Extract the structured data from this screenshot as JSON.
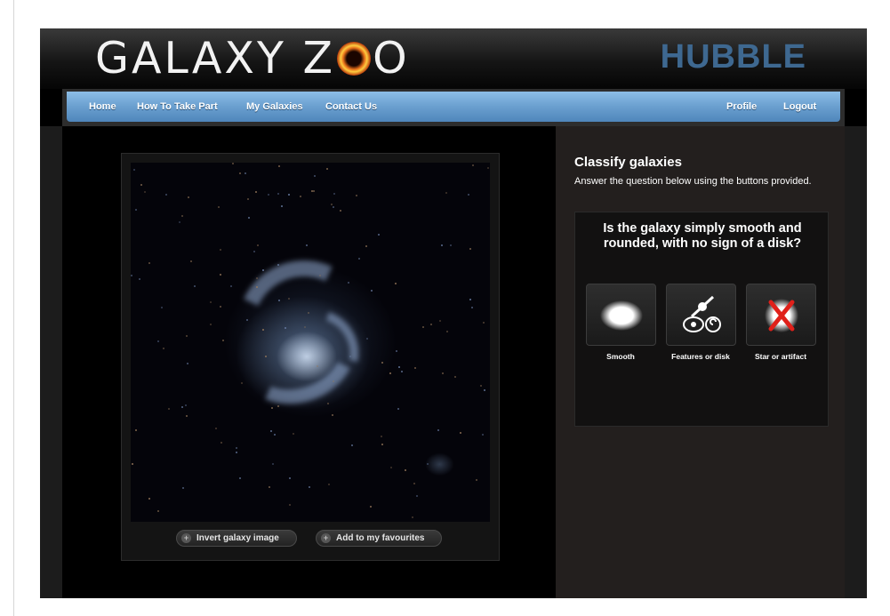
{
  "header": {
    "logo_text": "GALAXY ZOO",
    "project": "HUBBLE"
  },
  "nav": {
    "left": [
      "Home",
      "How To Take Part",
      "My Galaxies",
      "Contact Us"
    ],
    "right": [
      "Profile",
      "Logout"
    ]
  },
  "image_panel": {
    "invert_label": "Invert galaxy image",
    "favourite_label": "Add to my favourites"
  },
  "classify": {
    "title": "Classify galaxies",
    "instructions": "Answer the question below using the buttons provided.",
    "question": "Is the galaxy simply smooth and rounded, with no sign of a disk?",
    "answers": [
      {
        "label": "Smooth",
        "icon": "smooth-galaxy-icon"
      },
      {
        "label": "Features or disk",
        "icon": "features-disk-icon"
      },
      {
        "label": "Star or artifact",
        "icon": "star-artifact-icon"
      }
    ]
  },
  "colors": {
    "nav_blue": "#6a9fcf",
    "hubble_blue": "#3e6890",
    "panel_bg": "#231f1e",
    "artifact_red": "#e0201a"
  }
}
